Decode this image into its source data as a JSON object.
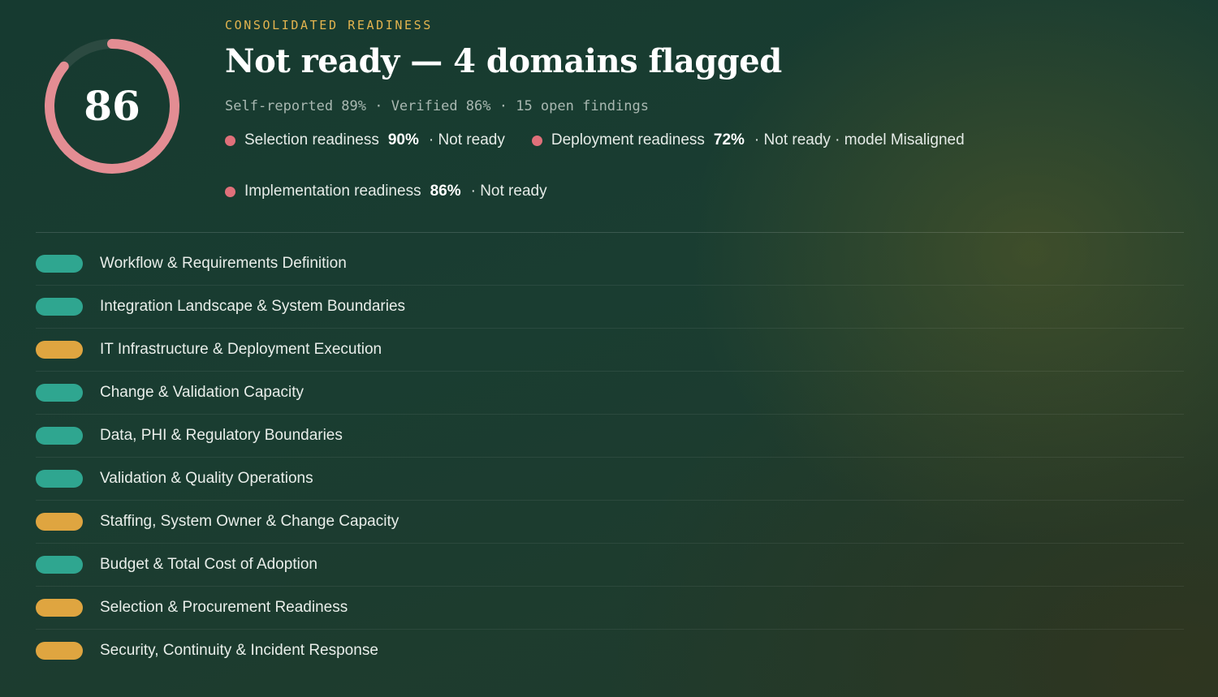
{
  "summary": {
    "score": "86",
    "score_fraction": 0.86,
    "ring_color": "#e38d93",
    "ring_track_color": "#2c4a41",
    "eyebrow": "CONSOLIDATED READINESS",
    "title": "Not ready — 4 domains flagged",
    "stats": "Self-reported 89% · Verified 86% · 15 open findings"
  },
  "readiness": [
    {
      "label": "Selection readiness",
      "percent": "90%",
      "status": "· Not ready",
      "dot_color": "#e0707a"
    },
    {
      "label": "Deployment readiness",
      "percent": "72%",
      "status": "· Not ready · model Misaligned",
      "dot_color": "#e0707a"
    },
    {
      "label": "Implementation readiness",
      "percent": "86%",
      "status": "· Not ready",
      "dot_color": "#e0707a"
    }
  ],
  "colors": {
    "ok": "#2fa690",
    "warn": "#dfa540",
    "accent": "#e3b44f"
  },
  "domains": [
    {
      "name": "Workflow & Requirements Definition",
      "status": "ok"
    },
    {
      "name": "Integration Landscape & System Boundaries",
      "status": "ok"
    },
    {
      "name": "IT Infrastructure & Deployment Execution",
      "status": "warn"
    },
    {
      "name": "Change & Validation Capacity",
      "status": "ok"
    },
    {
      "name": "Data, PHI & Regulatory Boundaries",
      "status": "ok"
    },
    {
      "name": "Validation & Quality Operations",
      "status": "ok"
    },
    {
      "name": "Staffing, System Owner & Change Capacity",
      "status": "warn"
    },
    {
      "name": "Budget & Total Cost of Adoption",
      "status": "ok"
    },
    {
      "name": "Selection & Procurement Readiness",
      "status": "warn"
    },
    {
      "name": "Security, Continuity & Incident Response",
      "status": "warn"
    }
  ]
}
